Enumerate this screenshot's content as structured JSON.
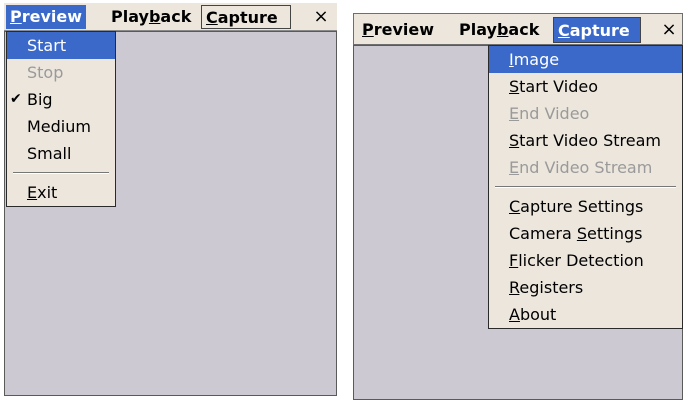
{
  "left_window": {
    "menubar": {
      "items": [
        {
          "prefix": "",
          "mnemonic": "P",
          "suffix": "review"
        },
        {
          "prefix": "Play",
          "mnemonic": "b",
          "suffix": "ack"
        },
        {
          "prefix": "",
          "mnemonic": "C",
          "suffix": "apture"
        }
      ],
      "close_glyph": "×"
    },
    "preview_menu": {
      "items": [
        {
          "label": "Start",
          "state": "highlighted"
        },
        {
          "label": "Stop",
          "state": "disabled"
        },
        {
          "label": "Big",
          "checked": true,
          "check_glyph": "✔"
        },
        {
          "label": "Medium"
        },
        {
          "label": "Small"
        }
      ],
      "exit": {
        "mnemonic": "E",
        "suffix": "xit"
      }
    }
  },
  "right_window": {
    "menubar": {
      "items": [
        {
          "prefix": "",
          "mnemonic": "P",
          "suffix": "review"
        },
        {
          "prefix": "Play",
          "mnemonic": "b",
          "suffix": "ack"
        },
        {
          "prefix": "",
          "mnemonic": "C",
          "suffix": "apture"
        }
      ],
      "close_glyph": "×"
    },
    "capture_menu": {
      "group1": [
        {
          "mnemonic": "I",
          "suffix": "mage",
          "state": "highlighted"
        },
        {
          "mnemonic": "S",
          "suffix": "tart Video"
        },
        {
          "mnemonic": "E",
          "suffix": "nd Video",
          "state": "disabled"
        },
        {
          "mnemonic": "S",
          "suffix": "tart Video Stream"
        },
        {
          "mnemonic": "E",
          "suffix": "nd Video Stream",
          "state": "disabled"
        }
      ],
      "group2": [
        {
          "prefix": "",
          "mnemonic": "C",
          "suffix": "apture Settings"
        },
        {
          "prefix": "Camera ",
          "mnemonic": "S",
          "suffix": "ettings"
        },
        {
          "prefix": "",
          "mnemonic": "F",
          "suffix": "licker Detection"
        },
        {
          "prefix": "",
          "mnemonic": "R",
          "suffix": "egisters"
        },
        {
          "prefix": "",
          "mnemonic": "A",
          "suffix": "bout"
        }
      ]
    }
  }
}
